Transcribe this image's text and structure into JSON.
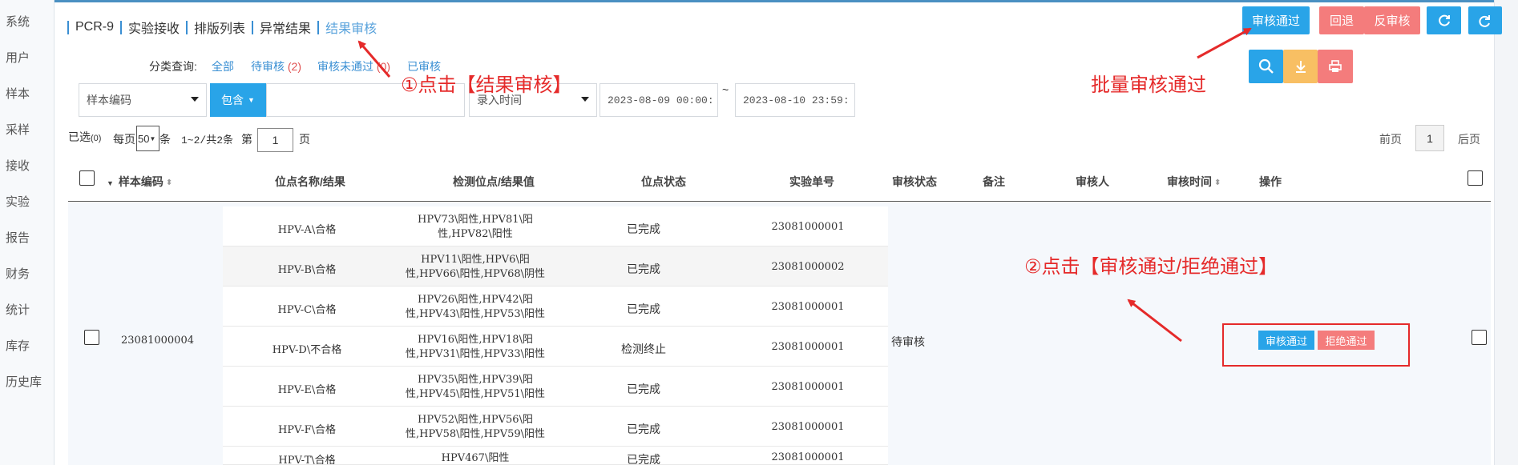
{
  "sidebar": {
    "items": [
      {
        "label": "系统"
      },
      {
        "label": "用户"
      },
      {
        "label": "样本"
      },
      {
        "label": "采样"
      },
      {
        "label": "接收"
      },
      {
        "label": "实验"
      },
      {
        "label": "报告"
      },
      {
        "label": "财务"
      },
      {
        "label": "统计"
      },
      {
        "label": "库存"
      },
      {
        "label": "历史库"
      }
    ]
  },
  "tabs": [
    {
      "label": "PCR-9"
    },
    {
      "label": "实验接收"
    },
    {
      "label": "排版列表"
    },
    {
      "label": "异常结果"
    },
    {
      "label": "结果审核",
      "active": true
    }
  ],
  "toolbar": {
    "approve_label": "审核通过",
    "return_label": "回退",
    "reverse_label": "反审核",
    "refresh_icon": "refresh-icon",
    "redo_icon": "redo-icon",
    "search_icon": "search-icon",
    "download_icon": "download-icon",
    "print_icon": "print-icon"
  },
  "filter": {
    "label": "分类查询:",
    "options": [
      {
        "label": "全部",
        "count": ""
      },
      {
        "label": "待审核",
        "count": "(2)"
      },
      {
        "label": "审核未通过",
        "count": "(0)"
      },
      {
        "label": "已审核",
        "count": ""
      }
    ]
  },
  "search": {
    "field_select": "样本编码",
    "match_label": "包含",
    "input_value": "",
    "time_select": "录入时间",
    "start_time": "2023-08-09 00:00:",
    "range_sep": "~",
    "end_time": "2023-08-10 23:59:"
  },
  "pager": {
    "selected_label": "已选",
    "selected_count": "(0)",
    "per_page_prefix": "每页",
    "per_page_value": "50",
    "per_page_suffix": "条",
    "range_text": "1~2/共2条",
    "page_prefix": "第",
    "page_value": "1",
    "page_suffix": "页",
    "prev_label": "前页",
    "current_page": "1",
    "next_label": "后页"
  },
  "table": {
    "headers": {
      "sample_code": "样本编码",
      "site_name": "位点名称/结果",
      "detect": "检测位点/结果值",
      "site_status": "位点状态",
      "order_no": "实验单号",
      "review_status": "审核状态",
      "remark": "备注",
      "reviewer": "审核人",
      "review_time": "审核时间",
      "action": "操作"
    },
    "group": {
      "sample_code": "23081000004",
      "review_status": "待审核",
      "approve_label": "审核通过",
      "reject_label": "拒绝通过"
    },
    "rows": [
      {
        "result": "HPV-A\\合格",
        "detect1": "HPV73\\阳性,HPV81\\阳",
        "detect2": "性,HPV82\\阳性",
        "status": "已完成",
        "order": "23081000001"
      },
      {
        "result": "HPV-B\\合格",
        "detect1": "HPV11\\阳性,HPV6\\阳",
        "detect2": "性,HPV66\\阳性,HPV68\\阴性",
        "status": "已完成",
        "order": "23081000002"
      },
      {
        "result": "HPV-C\\合格",
        "detect1": "HPV26\\阳性,HPV42\\阳",
        "detect2": "性,HPV43\\阳性,HPV53\\阳性",
        "status": "已完成",
        "order": "23081000001"
      },
      {
        "result": "HPV-D\\不合格",
        "detect1": "HPV16\\阳性,HPV18\\阳",
        "detect2": "性,HPV31\\阳性,HPV33\\阳性",
        "status": "检测终止",
        "order": "23081000001"
      },
      {
        "result": "HPV-E\\合格",
        "detect1": "HPV35\\阳性,HPV39\\阳",
        "detect2": "性,HPV45\\阳性,HPV51\\阳性",
        "status": "已完成",
        "order": "23081000001"
      },
      {
        "result": "HPV-F\\合格",
        "detect1": "HPV52\\阳性,HPV56\\阳",
        "detect2": "性,HPV58\\阳性,HPV59\\阳性",
        "status": "已完成",
        "order": "23081000001"
      },
      {
        "result": "HPV-T\\合格",
        "detect1": "HPV467\\阳性",
        "detect2": "",
        "status": "已完成",
        "order": "23081000001"
      }
    ]
  },
  "annotations": {
    "step1": "①点击【结果审核】",
    "batch": "批量审核通过",
    "step2": "②点击【审核通过/拒绝通过】"
  },
  "colors": {
    "primary": "#29a4e8",
    "danger": "#f47c7c",
    "warning": "#f8bf63",
    "annotation": "#e52a2a"
  }
}
